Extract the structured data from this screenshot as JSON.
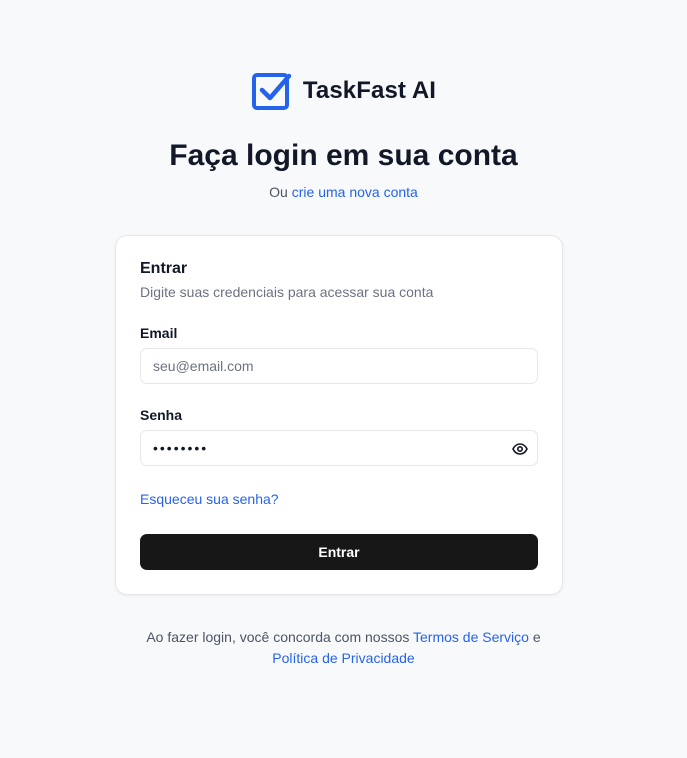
{
  "brand": {
    "name": "TaskFast AI",
    "logo_icon": "checkbox-icon",
    "accent": "#2563eb"
  },
  "header": {
    "title": "Faça login em sua conta",
    "subtitle_prefix": "Ou",
    "signup_link": "crie uma nova conta"
  },
  "card": {
    "title": "Entrar",
    "description": "Digite suas credenciais para acessar sua conta",
    "email": {
      "label": "Email",
      "placeholder": "seu@email.com",
      "value": ""
    },
    "password": {
      "label": "Senha",
      "value": "••••••••",
      "toggle_icon": "eye-icon"
    },
    "forgot_link": "Esqueceu sua senha?",
    "submit_label": "Entrar"
  },
  "footer": {
    "prefix": "Ao fazer login, você concorda com nossos",
    "terms_link": "Termos de Serviço",
    "conjunction": "e",
    "privacy_link": "Política de Privacidade"
  },
  "colors": {
    "background": "#f8f9fb",
    "link": "#2563eb",
    "button": "#171717"
  }
}
